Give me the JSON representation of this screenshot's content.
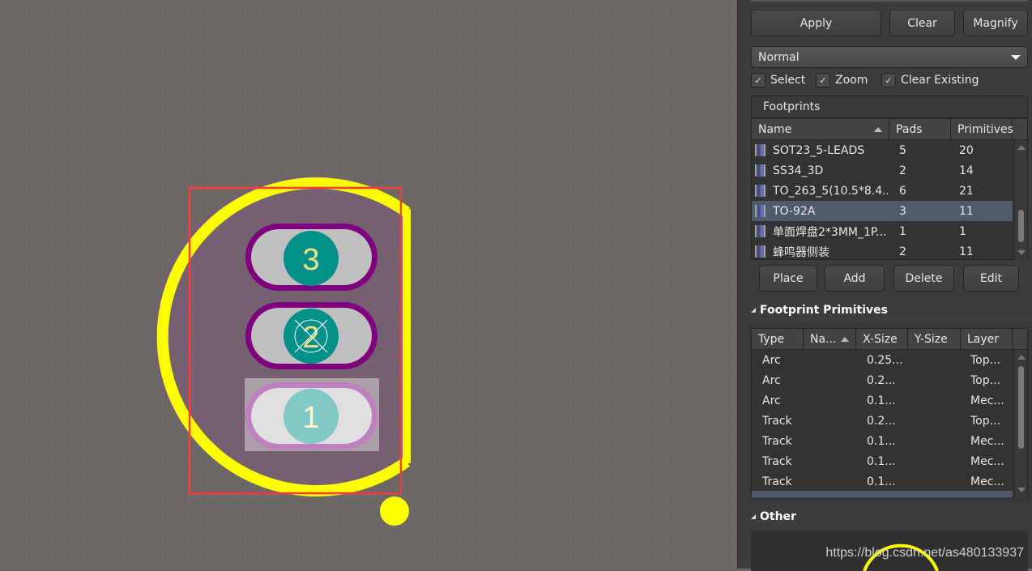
{
  "canvas": {
    "pads": [
      {
        "number": "3",
        "selected": false
      },
      {
        "number": "2",
        "selected": false,
        "origin_marker": true
      },
      {
        "number": "1",
        "selected": true
      }
    ],
    "colors": {
      "silkscreen": "#ffff00",
      "courtyard_hatch": "#c020c0",
      "selection_box": "#ff3a3a",
      "pad_outline": "#7e007e",
      "pad_copper": "#c0c0c0",
      "hole": "#00908a",
      "pad_label": "#f5e08a",
      "background": "#6c6866"
    }
  },
  "panel": {
    "buttons": {
      "apply": "Apply",
      "clear": "Clear",
      "magnify": "Magnify"
    },
    "mode_dropdown": {
      "selected": "Normal"
    },
    "checkboxes": [
      {
        "label": "Select",
        "checked": true
      },
      {
        "label": "Zoom",
        "checked": true
      },
      {
        "label": "Clear Existing",
        "checked": true
      }
    ],
    "footprints": {
      "title": "Footprints",
      "columns": [
        "Name",
        "Pads",
        "Primitives"
      ],
      "rows": [
        {
          "name": "SOT23_5-LEADS",
          "pads": "5",
          "primitives": "20",
          "selected": false
        },
        {
          "name": "SS34_3D",
          "pads": "2",
          "primitives": "14",
          "selected": false
        },
        {
          "name": "TO_263_5(10.5*8.4...",
          "pads": "6",
          "primitives": "21",
          "selected": false
        },
        {
          "name": "TO-92A",
          "pads": "3",
          "primitives": "11",
          "selected": true
        },
        {
          "name": "单面焊盘2*3MM_1P...",
          "pads": "1",
          "primitives": "1",
          "selected": false
        },
        {
          "name": "蜂鸣器侧装",
          "pads": "2",
          "primitives": "11",
          "selected": false
        }
      ],
      "actions": {
        "place": "Place",
        "add": "Add",
        "delete": "Delete",
        "edit": "Edit"
      }
    },
    "primitives": {
      "title": "Footprint Primitives",
      "columns": [
        "Type",
        "Na...",
        "X-Size",
        "Y-Size",
        "Layer"
      ],
      "rows": [
        {
          "type": "Arc",
          "name": "",
          "x_size": "0.25...",
          "y_size": "",
          "layer": "Top..."
        },
        {
          "type": "Arc",
          "name": "",
          "x_size": "0.2...",
          "y_size": "",
          "layer": "Top..."
        },
        {
          "type": "Arc",
          "name": "",
          "x_size": "0.1...",
          "y_size": "",
          "layer": "Mec..."
        },
        {
          "type": "Track",
          "name": "",
          "x_size": "0.2...",
          "y_size": "",
          "layer": "Top..."
        },
        {
          "type": "Track",
          "name": "",
          "x_size": "0.1...",
          "y_size": "",
          "layer": "Mec..."
        },
        {
          "type": "Track",
          "name": "",
          "x_size": "0.1...",
          "y_size": "",
          "layer": "Mec..."
        },
        {
          "type": "Track",
          "name": "",
          "x_size": "0.1...",
          "y_size": "",
          "layer": "Mec..."
        }
      ]
    },
    "other": {
      "title": "Other"
    }
  },
  "watermark": "https://blog.csdn.net/as480133937"
}
